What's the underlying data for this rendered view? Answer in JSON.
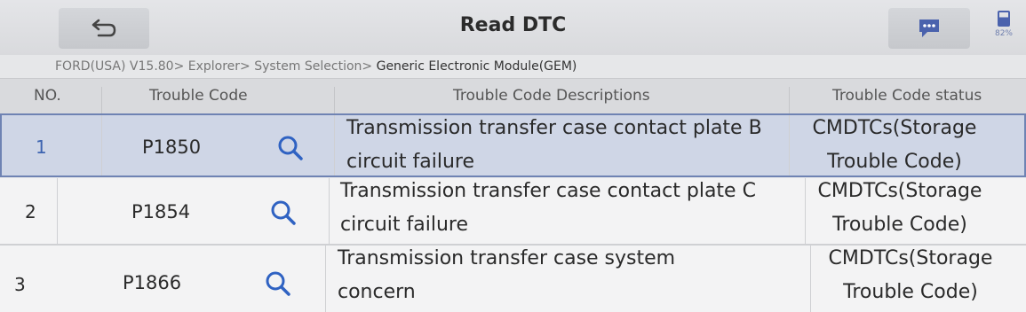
{
  "header": {
    "title": "Read DTC",
    "battery": "82%"
  },
  "breadcrumb": {
    "path": "FORD(USA) V15.80> Explorer> System Selection> ",
    "current": "Generic Electronic Module(GEM)"
  },
  "table": {
    "columns": [
      "NO.",
      "Trouble Code",
      "Trouble Code Descriptions",
      "Trouble Code status"
    ],
    "rows": [
      {
        "no": "1",
        "code": "P1850",
        "desc_line1": "Transmission transfer case contact plate B",
        "desc_line2": "circuit failure",
        "status_line1": "CMDTCs(Storage",
        "status_line2": "Trouble Code)"
      },
      {
        "no": "2",
        "code": "P1854",
        "desc_line1": "Transmission transfer case contact plate C",
        "desc_line2": "circuit failure",
        "status_line1": "CMDTCs(Storage",
        "status_line2": "Trouble Code)"
      },
      {
        "no": "3",
        "code": "P1866",
        "desc_line1": "Transmission transfer case system",
        "desc_line2": "concern",
        "status_line1": "CMDTCs(Storage",
        "status_line2": "Trouble Code)"
      }
    ]
  },
  "colors": {
    "accent": "#3d64b0",
    "selected_row": "#cfd6e6"
  },
  "icons": {
    "back": "back-arrow-icon",
    "message": "message-icon",
    "search": "search-icon",
    "battery": "battery-icon"
  }
}
